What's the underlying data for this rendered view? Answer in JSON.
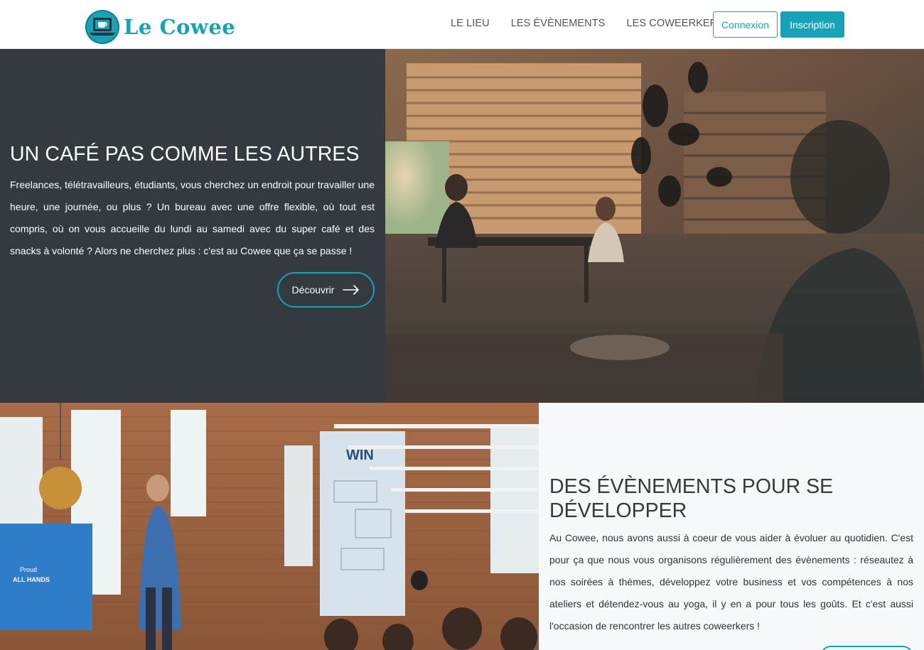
{
  "header": {
    "brand": "Le Cowee",
    "nav": [
      "LE LIEU",
      "LES ÉVÈNEMENTS",
      "LES COWEERKERS"
    ],
    "login_label": "Connexion",
    "signup_label": "Inscription",
    "accent_color": "#17a2b8"
  },
  "hero": {
    "title": "UN CAFÉ PAS COMME LES AUTRES",
    "description": "Freelances, télétravailleurs, étudiants, vous cherchez un endroit pour travailler une heure, une journée, ou plus ? Un bureau avec une offre flexible, où tout est compris, où on vous accueille du lundi au samedi avec du super café et des snacks à volonté ? Alors ne cherchez plus : c'est au Cowee que ça se passe !",
    "button_label": "Découvrir",
    "button_icon": "arrow-right-icon",
    "background_color": "#343a40"
  },
  "events": {
    "title": "DES ÉVÈNEMENTS POUR SE DÉVELOPPER",
    "description": "Au Cowee, nous avons aussi à coeur de vous aider à évoluer au quotidien. C'est pour ça que nous vous organisons régulièrement des évènements : réseautez à nos soirées à thèmes, développez votre business et vos compétences à nos ateliers et détendez-vous au yoga, il y en a pour tous les goûts. Et c'est aussi l'occasion de rencontrer les autres coweerkers !",
    "slide_text_line1": "Proud",
    "slide_text_line2": "ALL HANDS",
    "sign_text": "WIN"
  }
}
